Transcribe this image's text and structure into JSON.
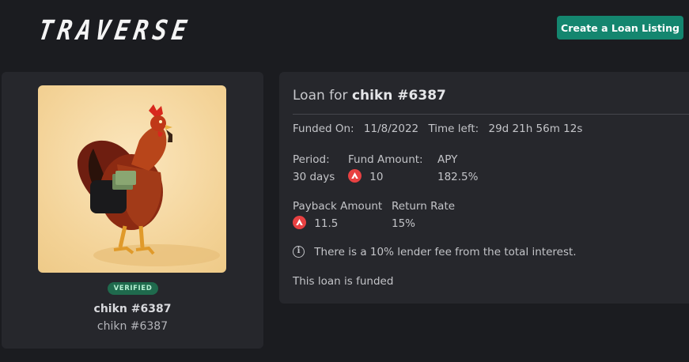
{
  "header": {
    "logo_text": "TRAVERSE",
    "create_button_label": "Create a Loan Listing"
  },
  "nft": {
    "badge": "VERIFIED",
    "name": "chikn #6387",
    "collection": "chikn #6387"
  },
  "loan": {
    "title_prefix": "Loan for",
    "title_name": "chikn #6387",
    "funded_on_label": "Funded On:",
    "funded_on_value": "11/8/2022",
    "time_left_label": "Time left:",
    "time_left_value": "29d 21h 56m 12s",
    "period_label": "Period:",
    "period_value": "30 days",
    "fund_amount_label": "Fund Amount:",
    "fund_amount_value": "10",
    "apy_label": "APY",
    "apy_value": "182.5%",
    "payback_label": "Payback Amount",
    "payback_value": "11.5",
    "return_rate_label": "Return Rate",
    "return_rate_value": "15%",
    "fee_note": "There is a 10% lender fee from the total interest.",
    "status": "This loan is funded"
  },
  "icons": {
    "token": "avalanche-icon",
    "info": "info-icon"
  },
  "colors": {
    "background": "#1b1c20",
    "card": "#26272c",
    "accent_button": "#14866f",
    "verified_badge": "#1f6a4d",
    "token_red": "#e84142"
  }
}
